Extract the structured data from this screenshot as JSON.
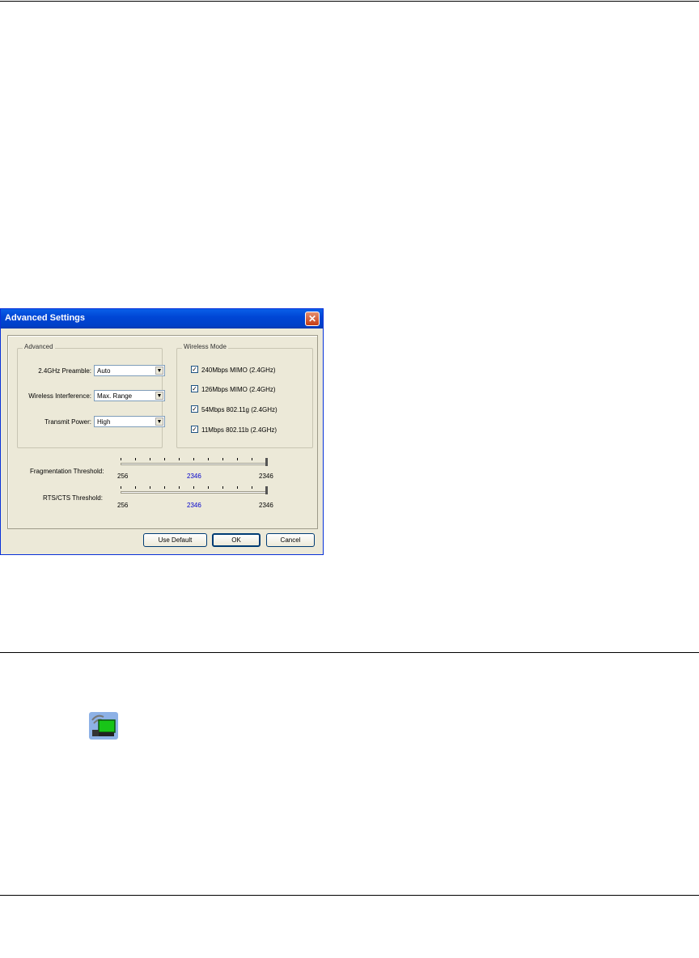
{
  "dialog": {
    "title": "Advanced Settings",
    "close_label": "✕",
    "advanced_group": {
      "label": "Advanced",
      "preamble_label": "2.4GHz Preamble:",
      "preamble_value": "Auto",
      "interference_label": "Wireless Interference:",
      "interference_value": "Max. Range",
      "power_label": "Transmit Power:",
      "power_value": "High"
    },
    "wireless_mode": {
      "label": "Wireless Mode",
      "items": [
        {
          "label": "240Mbps MIMO (2.4GHz)",
          "checked": true
        },
        {
          "label": "126Mbps MIMO (2.4GHz)",
          "checked": true
        },
        {
          "label": "54Mbps 802.11g (2.4GHz)",
          "checked": true
        },
        {
          "label": "11Mbps 802.11b (2.4GHz)",
          "checked": true
        }
      ]
    },
    "fragmentation": {
      "label": "Fragmentation Threshold:",
      "min": "256",
      "current": "2346",
      "max": "2346",
      "fraction": 1.0
    },
    "rts": {
      "label": "RTS/CTS Threshold:",
      "min": "256",
      "current": "2346",
      "max": "2346",
      "fraction": 1.0
    },
    "buttons": {
      "use_default": "Use Default",
      "ok": "OK",
      "cancel": "Cancel"
    }
  },
  "colors": {
    "titlebar": "#0046d5",
    "current_value": "#0000cc",
    "dialog_bg": "#ece9d8"
  },
  "icon": {
    "name": "wireless-network-icon"
  }
}
